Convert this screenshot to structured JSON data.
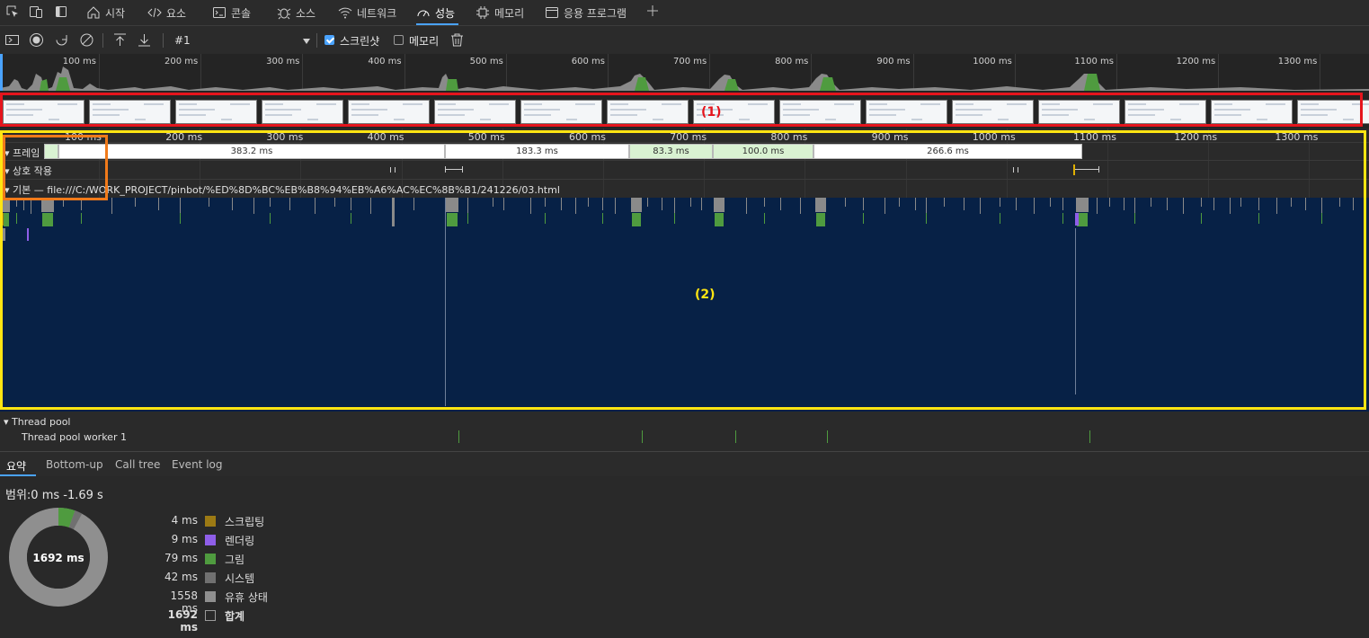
{
  "tabs": [
    {
      "label": "시작",
      "icon": "home-icon"
    },
    {
      "label": "요소",
      "icon": "code-icon"
    },
    {
      "label": "콘솔",
      "icon": "console-icon"
    },
    {
      "label": "소스",
      "icon": "bug-icon"
    },
    {
      "label": "네트워크",
      "icon": "wifi-icon"
    },
    {
      "label": "성능",
      "icon": "gauge-icon",
      "active": true
    },
    {
      "label": "메모리",
      "icon": "chip-icon"
    },
    {
      "label": "응용 프로그램",
      "icon": "window-icon"
    }
  ],
  "toolbar": {
    "recording_select": "#1",
    "screenshots_label": "스크린샷",
    "screenshots_checked": true,
    "memory_label": "메모리",
    "memory_checked": false
  },
  "overview_ticks": [
    "100 ms",
    "200 ms",
    "300 ms",
    "400 ms",
    "500 ms",
    "600 ms",
    "700 ms",
    "800 ms",
    "900 ms",
    "1000 ms",
    "1100 ms",
    "1200 ms",
    "1300 ms"
  ],
  "flame_ticks": [
    "100 ms",
    "200 ms",
    "300 ms",
    "400 ms",
    "500 ms",
    "600 ms",
    "700 ms",
    "800 ms",
    "900 ms",
    "1000 ms",
    "1100 ms",
    "1200 ms",
    "1300 ms"
  ],
  "tracks": {
    "frames": "프레임",
    "interactions": "상호 작용",
    "main": "기본 — file:///C:/WORK_PROJECT/pinbot/%ED%8D%BC%EB%B8%94%EB%A6%AC%EC%8B%B1/241226/03.html",
    "thread_pool": "Thread pool",
    "thread_pool_worker": "Thread pool worker 1"
  },
  "frames": [
    {
      "label": "383.2 ms",
      "type": "white"
    },
    {
      "label": "183.3 ms",
      "type": "white"
    },
    {
      "label": "83.3 ms",
      "type": "green"
    },
    {
      "label": "100.0 ms",
      "type": "green"
    },
    {
      "label": "266.6 ms",
      "type": "white"
    }
  ],
  "annotations": {
    "one": "(1)",
    "two": "(2)"
  },
  "bottom_tabs": [
    "요약",
    "Bottom-up",
    "Call tree",
    "Event log"
  ],
  "summary": {
    "range": "범위:0 ms -1.69 s",
    "total_center": "1692 ms",
    "rows": [
      {
        "value": "4 ms",
        "name": "스크립팅",
        "color": "#9c7a14"
      },
      {
        "value": "9 ms",
        "name": "렌더링",
        "color": "#8e5ee8"
      },
      {
        "value": "79 ms",
        "name": "그림",
        "color": "#4f9b3f"
      },
      {
        "value": "42 ms",
        "name": "시스템",
        "color": "#707070"
      },
      {
        "value": "1558 ms",
        "name": "유휴 상태",
        "color": "#8f8f8f"
      },
      {
        "value": "1692 ms",
        "name": "합계",
        "color": "transparent"
      }
    ]
  },
  "colors": {
    "main_bg": "#072146",
    "red_box": "#e5141c",
    "yellow_box": "#ffe512",
    "orange_box": "#f07a1a",
    "accent": "#4aa3ff"
  }
}
